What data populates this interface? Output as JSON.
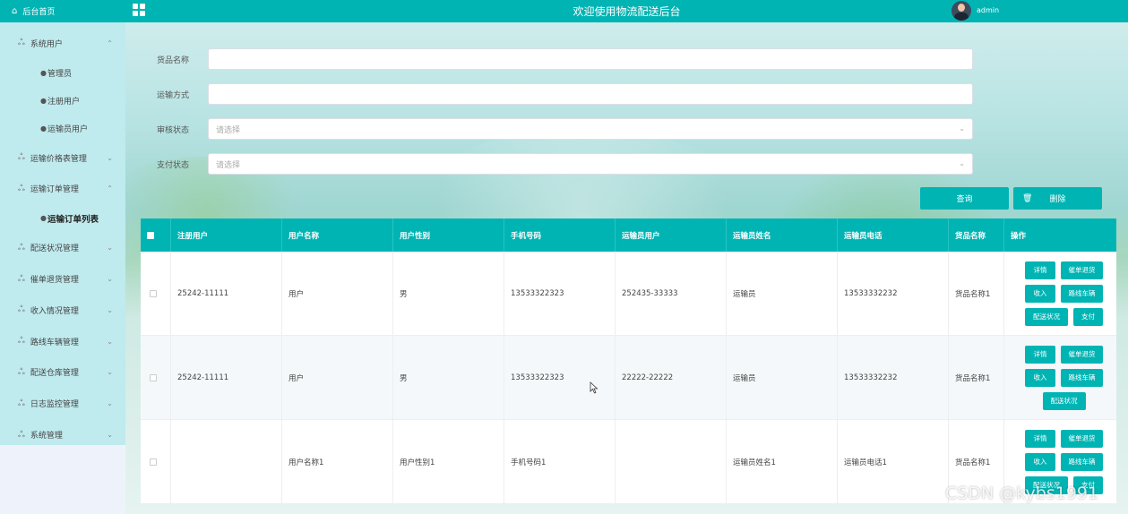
{
  "sidebar": {
    "home_label": "后台首页",
    "items": [
      {
        "label": "系统用户",
        "expanded": true,
        "children": [
          "管理员",
          "注册用户",
          "运输员用户"
        ]
      },
      {
        "label": "运输价格表管理",
        "expanded": false
      },
      {
        "label": "运输订单管理",
        "expanded": true,
        "children": [
          "运输订单列表"
        ]
      },
      {
        "label": "配送状况管理",
        "expanded": false
      },
      {
        "label": "催单退货管理",
        "expanded": false
      },
      {
        "label": "收入情况管理",
        "expanded": false
      },
      {
        "label": "路线车辆管理",
        "expanded": false
      },
      {
        "label": "配送仓库管理",
        "expanded": false
      },
      {
        "label": "日志监控管理",
        "expanded": false
      },
      {
        "label": "系统管理",
        "expanded": false
      }
    ],
    "active_item": "运输订单列表"
  },
  "header": {
    "title": "欢迎使用物流配送后台",
    "username": "admin"
  },
  "filters": [
    {
      "label": "货品名称",
      "value": "",
      "placeholder": ""
    },
    {
      "label": "运输方式",
      "value": "",
      "placeholder": ""
    },
    {
      "label": "审核状态",
      "value": "",
      "placeholder": "请选择"
    },
    {
      "label": "支付状态",
      "value": "",
      "placeholder": "请选择"
    }
  ],
  "buttons": {
    "search": "查询",
    "delete": "删除"
  },
  "table": {
    "columns": [
      "注册用户",
      "用户名称",
      "用户性别",
      "手机号码",
      "运输员用户",
      "运输员姓名",
      "运输员电话",
      "货品名称",
      "操作"
    ],
    "rows": [
      [
        "25242-11111",
        "用户",
        "男",
        "13533322323",
        "252435-33333",
        "运输员",
        "13533332232",
        "货品名称1"
      ],
      [
        "25242-11111",
        "用户",
        "男",
        "13533322323",
        "22222-22222",
        "运输员",
        "13533332232",
        "货品名称1"
      ],
      [
        "",
        "用户名称1",
        "用户性别1",
        "手机号码1",
        "",
        "运输员姓名1",
        "运输员电话1",
        "货品名称1"
      ]
    ],
    "ops": {
      "detail": "详情",
      "urge_return": "催单退货",
      "income": "收入",
      "route_vehicle": "路线车辆",
      "delivery_status": "配送状况",
      "pay": "支付"
    }
  },
  "watermark": "CSDN @kybs1991",
  "colors": {
    "primary": "#00b4b4",
    "sidebar_bg": "#bfeaee"
  }
}
